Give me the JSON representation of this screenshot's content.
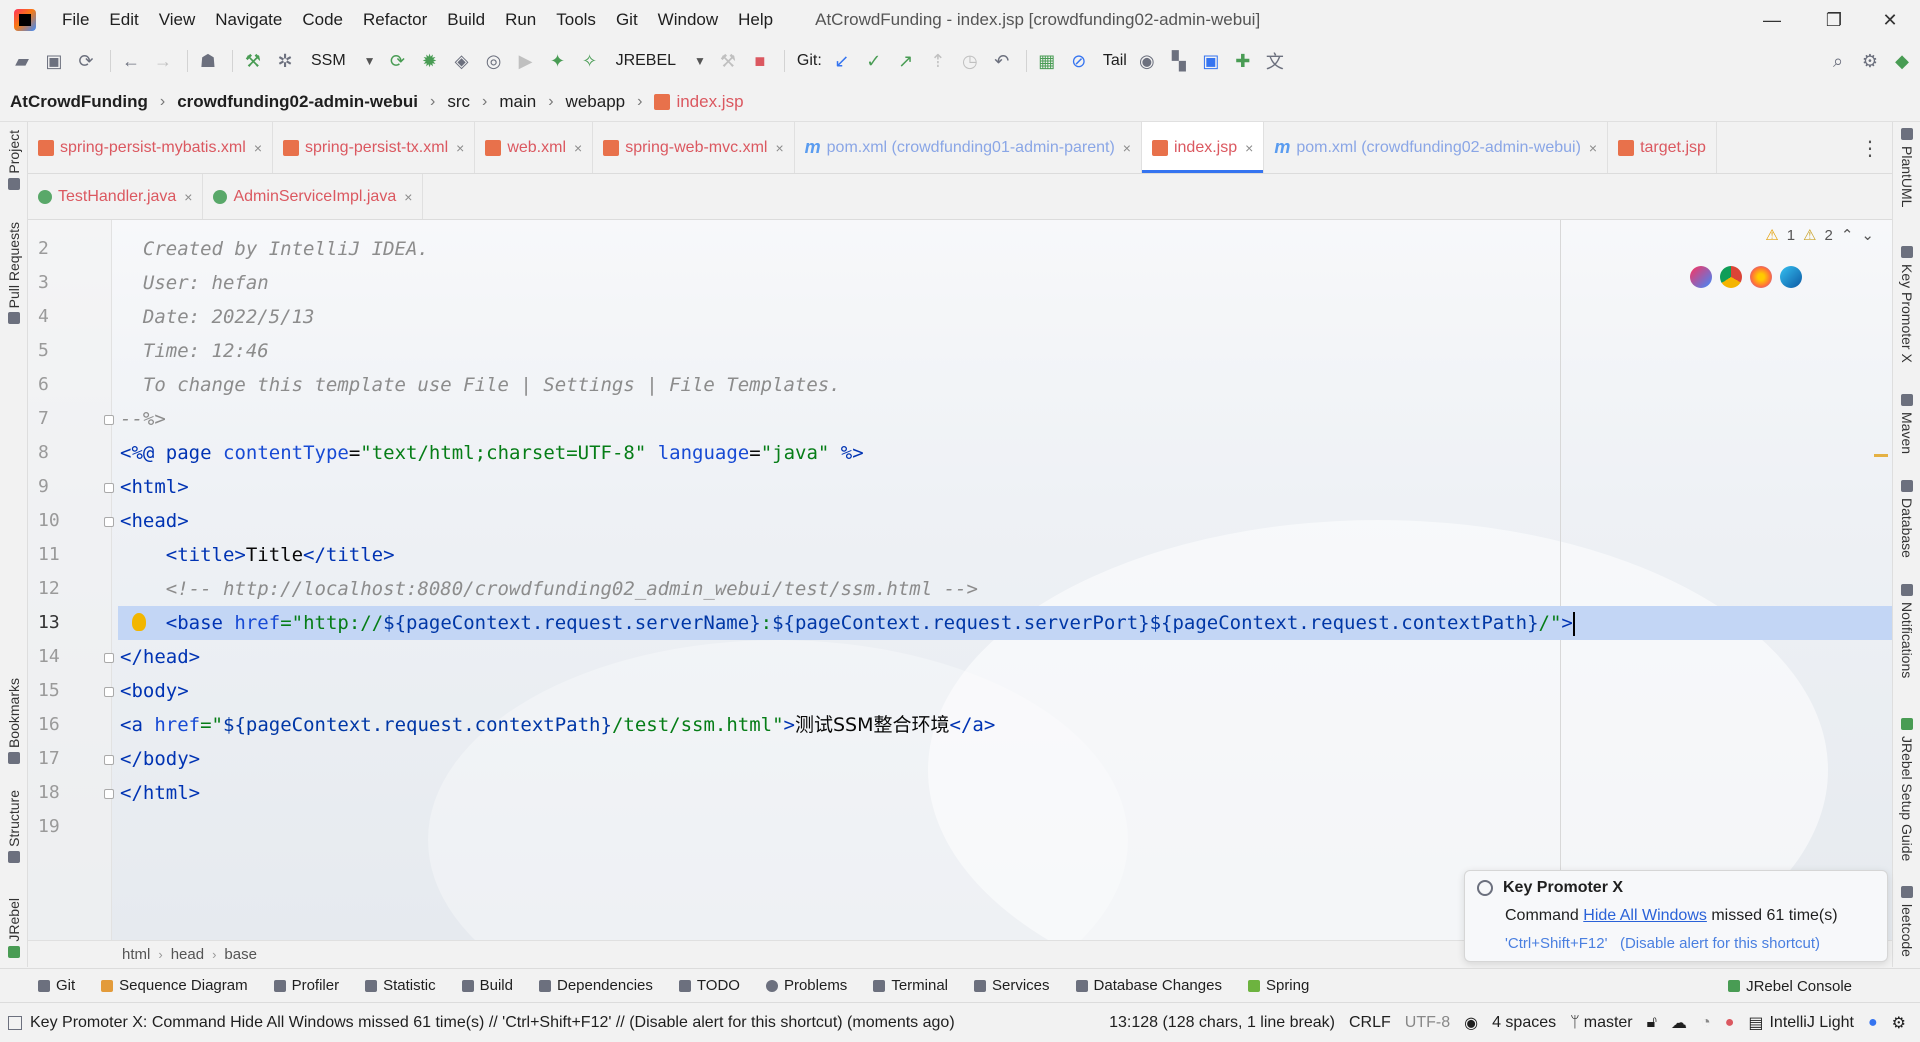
{
  "menubar": {
    "items": [
      "File",
      "Edit",
      "View",
      "Navigate",
      "Code",
      "Refactor",
      "Build",
      "Run",
      "Tools",
      "Git",
      "Window",
      "Help"
    ],
    "window_title": "AtCrowdFunding - index.jsp [crowdfunding02-admin-webui]",
    "controls": {
      "minimize": "—",
      "restore": "❐",
      "close": "✕"
    }
  },
  "toolbar": {
    "run_config": "SSM",
    "jrebel": "JREBEL",
    "git_label": "Git:",
    "tail_label": "Tail"
  },
  "breadcrumb": {
    "project": "AtCrowdFunding",
    "module": "crowdfunding02-admin-webui",
    "dirs": [
      "src",
      "main",
      "webapp"
    ],
    "file": "index.jsp"
  },
  "left_strip": {
    "project": "Project",
    "pull_requests": "Pull Requests",
    "bookmarks": "Bookmarks",
    "structure": "Structure",
    "jrebel": "JRebel"
  },
  "right_strip": {
    "plantuml": "PlantUML",
    "key_promoter": "Key Promoter X",
    "maven": "Maven",
    "database": "Database",
    "notifications": "Notifications",
    "jrebel_guide": "JRebel Setup Guide",
    "leetcode": "leetcode"
  },
  "tabs_row1": [
    {
      "label": "spring-persist-mybatis.xml",
      "kind": "xml"
    },
    {
      "label": "spring-persist-tx.xml",
      "kind": "xml"
    },
    {
      "label": "web.xml",
      "kind": "xml"
    },
    {
      "label": "spring-web-mvc.xml",
      "kind": "xml"
    },
    {
      "label": "pom.xml (crowdfunding01-admin-parent)",
      "kind": "maven"
    },
    {
      "label": "index.jsp",
      "kind": "jsp"
    },
    {
      "label": "pom.xml (crowdfunding02-admin-webui)",
      "kind": "maven"
    },
    {
      "label": "target.jsp",
      "kind": "jsp"
    }
  ],
  "tabs_row2": [
    {
      "label": "TestHandler.java",
      "kind": "java"
    },
    {
      "label": "AdminServiceImpl.java",
      "kind": "java"
    }
  ],
  "tab_close": "×",
  "inspections": {
    "warnings": "1",
    "weak_warnings": "2"
  },
  "line_numbers": [
    "2",
    "3",
    "4",
    "5",
    "6",
    "7",
    "8",
    "9",
    "10",
    "11",
    "12",
    "13",
    "14",
    "15",
    "16",
    "17",
    "18",
    "19"
  ],
  "code": {
    "l2": "Created by IntelliJ IDEA.",
    "l3": "User: hefan",
    "l4": "Date: 2022/5/13",
    "l5": "Time: 12:46",
    "l6": "To change this template use File | Settings | File Templates.",
    "l7": "--%>",
    "l8_open": "<%@",
    "l8_page": "page",
    "l8_ct_attr": "contentType",
    "l8_ct_val": "\"text/html;charset=UTF-8\"",
    "l8_lang_attr": "language",
    "l8_lang_val": "\"java\"",
    "l8_close": "%>",
    "l9": "<html>",
    "l10": "<head>",
    "l11_open": "<title>",
    "l11_text": "Title",
    "l11_close": "</title>",
    "l12": "<!-- http://localhost:8080/crowdfunding02_admin_webui/test/ssm.html -->",
    "l13_tag": "<base",
    "l13_attr": "href",
    "l13_q": "=\"http://",
    "l13_el1": "${pageContext.request.serverName}",
    "l13_colon": ":",
    "l13_el2": "${pageContext.request.serverPort}",
    "l13_el3": "${pageContext.request.contextPath}",
    "l13_end": "/\"",
    "l13_close": ">",
    "l14": "</head>",
    "l15": "<body>",
    "l16_tag": "<a",
    "l16_attr": "href",
    "l16_q": "=\"",
    "l16_el": "${pageContext.request.contextPath}",
    "l16_path": "/test/ssm.html\"",
    "l16_gt": ">",
    "l16_text": "测试SSM整合环境",
    "l16_close": "</a>",
    "l17": "</body>",
    "l18": "</html>"
  },
  "editor_crumbs": [
    "html",
    "head",
    "base"
  ],
  "toolwindows": [
    "Git",
    "Sequence Diagram",
    "Profiler",
    "Statistic",
    "Build",
    "Dependencies",
    "TODO",
    "Problems",
    "Terminal",
    "Services",
    "Database Changes",
    "Spring"
  ],
  "jrebel_console": "JRebel Console",
  "status": {
    "message": "Key Promoter X: Command Hide All Windows missed 61 time(s) // 'Ctrl+Shift+F12' // (Disable alert for this shortcut) (moments ago)",
    "position": "13:128 (128 chars, 1 line break)",
    "line_sep": "CRLF",
    "encoding": "UTF-8",
    "indent": "4 spaces",
    "branch": "master",
    "theme": "IntelliJ Light"
  },
  "popup": {
    "title": "Key Promoter X",
    "prefix": "Command",
    "link": "Hide All Windows",
    "suffix": "missed 61 time(s)",
    "shortcut": "'Ctrl+Shift+F12'",
    "disable": "(Disable alert for this shortcut)"
  },
  "colors": {
    "accent": "#3574f0",
    "selection": "#c3d6f5",
    "file_red": "#db5860"
  }
}
